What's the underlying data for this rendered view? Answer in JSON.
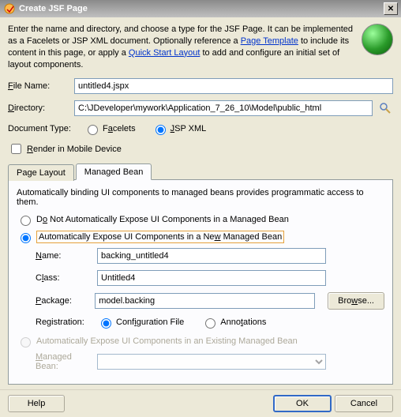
{
  "title": "Create JSF Page",
  "intro": {
    "prefix": "Enter the name and directory, and choose a type for the JSF Page. It can be implemented as a Facelets or JSP XML document. Optionally reference a ",
    "link1": "Page Template",
    "mid": " to include its content in this page, or apply a ",
    "link2": "Quick Start Layout",
    "suffix": " to add and configure an initial set of layout components."
  },
  "fileNameLabel": "File Name:",
  "fileNameValue": "untitled4.jspx",
  "directoryLabel": "Directory:",
  "directoryValue": "C:\\JDeveloper\\mywork\\Application_7_26_10\\Model\\public_html",
  "docTypeLabel": "Document Type:",
  "faceletsLabel": "Facelets",
  "jspXmlLabel": "JSP XML",
  "renderMobileLabel": "Render in Mobile Device",
  "tabs": {
    "pageLayout": "Page Layout",
    "managedBean": "Managed Bean"
  },
  "panel": {
    "desc": "Automatically binding UI components to managed beans provides programmatic access to them.",
    "optNo": "Do Not Automatically Expose UI Components in a Managed Bean",
    "optNew": "Automatically Expose UI Components in a New Managed Bean",
    "nameLabel": "Name:",
    "nameValue": "backing_untitled4",
    "classLabel": "Class:",
    "classValue": "Untitled4",
    "packageLabel": "Package:",
    "packageValue": "model.backing",
    "browse": "Browse...",
    "regLabel": "Registration:",
    "regConfig": "Configuration File",
    "regAnno": "Annotations",
    "optExisting": "Automatically Expose UI Components in an Existing Managed Bean",
    "managedBeanLabel": "Managed Bean:"
  },
  "buttons": {
    "help": "Help",
    "ok": "OK",
    "cancel": "Cancel"
  }
}
